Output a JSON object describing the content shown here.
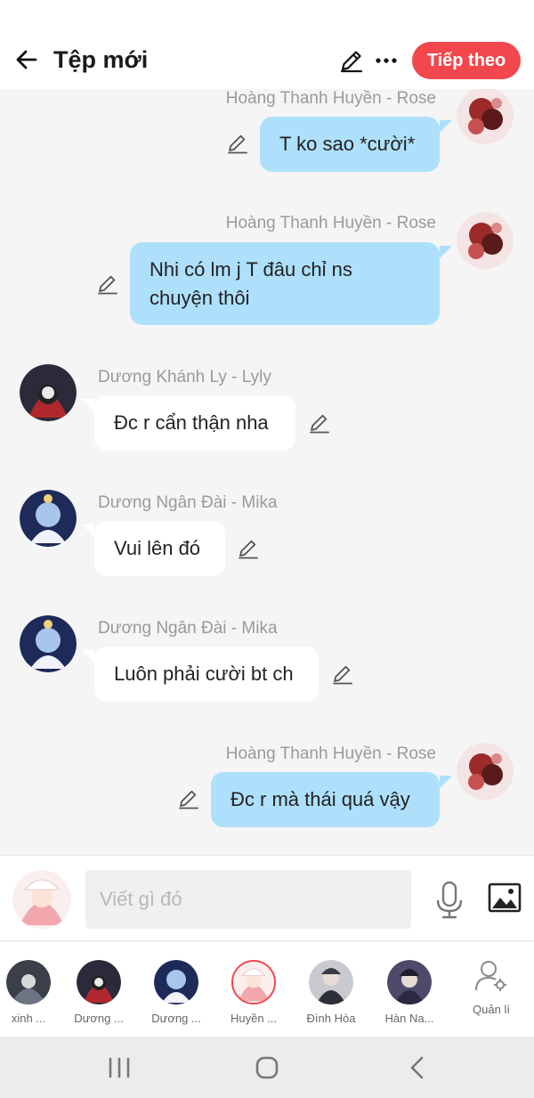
{
  "header": {
    "title": "Tệp mới",
    "next_label": "Tiếp theo"
  },
  "messages": [
    {
      "side": "out",
      "name": "Hoàng Thanh Huyền - Rose",
      "text": "T ko sao *cười*"
    },
    {
      "side": "out",
      "name": "Hoàng Thanh Huyền - Rose",
      "line1": "Nhi có lm j T đâu chỉ ns",
      "line2": "chuyện thôi"
    },
    {
      "side": "in",
      "name": "Dương Khánh Ly - Lyly",
      "text": "Đc r cẩn thận nha"
    },
    {
      "side": "in",
      "name": "Dương Ngân Đài - Mika",
      "text": "Vui lên đó"
    },
    {
      "side": "in",
      "name": "Dương Ngân Đài - Mika",
      "text": "Luôn phải cười bt ch"
    },
    {
      "side": "out",
      "name": "Hoàng Thanh Huyền - Rose",
      "text": "Đc r mà thái quá vậy"
    }
  ],
  "composer": {
    "placeholder": "Viết gì đó"
  },
  "members": [
    {
      "label": "xinh ..."
    },
    {
      "label": "Dương ..."
    },
    {
      "label": "Dương ..."
    },
    {
      "label": "Huyền ..."
    },
    {
      "label": "Đình Hòa"
    },
    {
      "label": "Hàn Na..."
    }
  ],
  "manage_label": "Quản lí",
  "colors": {
    "accent": "#f2474d",
    "outgoing_bubble": "#aee0fb",
    "incoming_bubble": "#ffffff",
    "background": "#f5f5f5"
  }
}
